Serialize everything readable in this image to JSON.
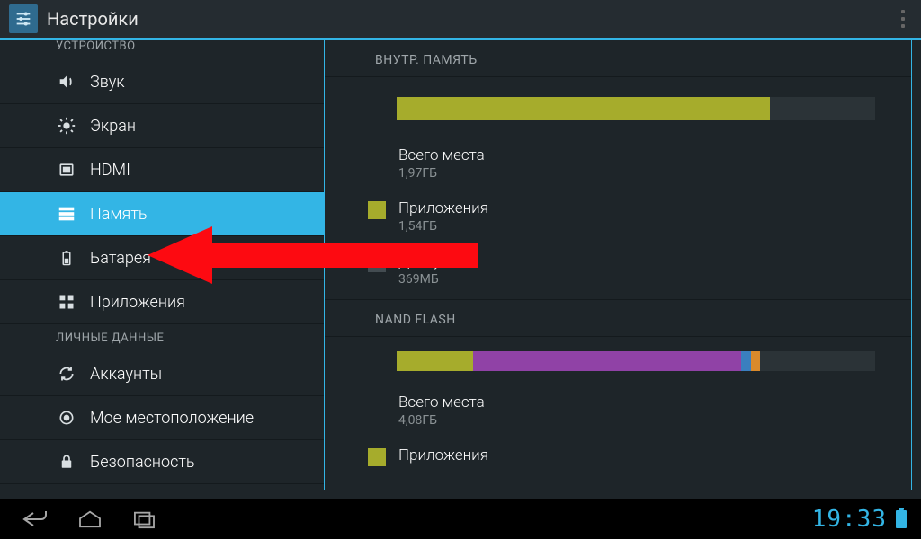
{
  "header": {
    "title": "Настройки"
  },
  "sidebar": {
    "section1": "Устройство",
    "section2": "Личные данные",
    "items": [
      {
        "label": "Звук"
      },
      {
        "label": "Экран"
      },
      {
        "label": "HDMI"
      },
      {
        "label": "Память"
      },
      {
        "label": "Батарея"
      },
      {
        "label": "Приложения"
      },
      {
        "label": "Аккаунты"
      },
      {
        "label": "Мое местоположение"
      },
      {
        "label": "Безопасность"
      }
    ]
  },
  "detail": {
    "internal": {
      "header": "Внутр. память",
      "bar": {
        "segments": [
          {
            "color": "#a6ac2c",
            "pct": 78
          }
        ]
      },
      "rows": [
        {
          "key": "Всего места",
          "value": "1,97ГБ",
          "chip": ""
        },
        {
          "key": "Приложения",
          "value": "1,54ГБ",
          "chip": "#a6ac2c"
        },
        {
          "key": "Доступно",
          "value": "369МБ",
          "chip": "#434c51"
        }
      ]
    },
    "nand": {
      "header": "NAND FLASH",
      "bar": {
        "segments": [
          {
            "color": "#a6ac2c",
            "pct": 16
          },
          {
            "color": "#9042a6",
            "pct": 56
          },
          {
            "color": "#3a7fbf",
            "pct": 2
          },
          {
            "color": "#d98a2b",
            "pct": 2
          }
        ]
      },
      "rows": [
        {
          "key": "Всего места",
          "value": "4,08ГБ",
          "chip": ""
        },
        {
          "key": "Приложения",
          "value": "",
          "chip": "#a6ac2c"
        }
      ]
    }
  },
  "statusbar": {
    "clock": "19:33"
  },
  "colors": {
    "accent": "#33b5e5"
  }
}
